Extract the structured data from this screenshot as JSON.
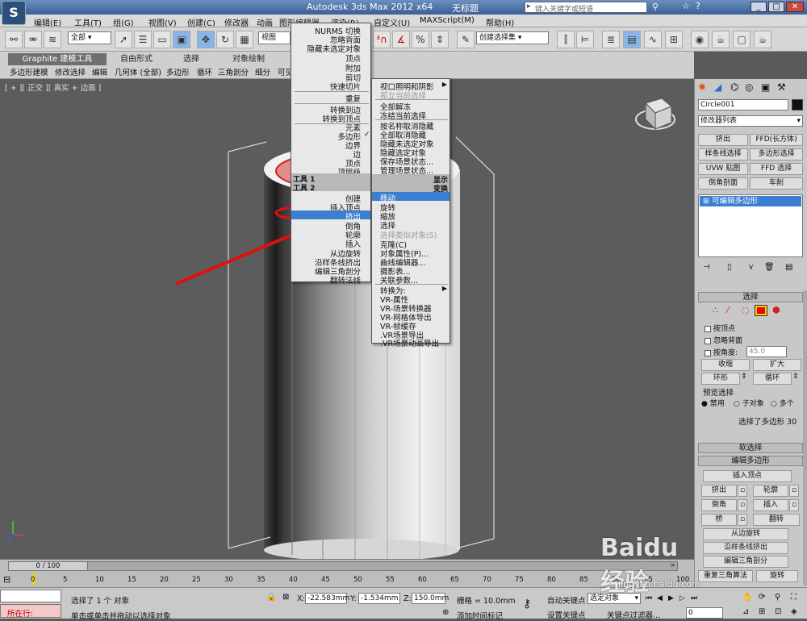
{
  "title": {
    "app": "Autodesk 3ds Max  2012 x64",
    "doc": "无标题",
    "search_placeholder": "键入关键字或短语"
  },
  "menubar": [
    "编辑(E)",
    "工具(T)",
    "组(G)",
    "视图(V)",
    "创建(C)",
    "修改器",
    "动画",
    "图形编辑器",
    "渲染(R)",
    "自定义(U)",
    "MAXScript(M)",
    "帮助(H)"
  ],
  "toolbar": {
    "filter_value": "全部",
    "view_value": "视图",
    "selection_set": "创建选择集"
  },
  "ribbon": {
    "tabs": [
      "Graphite 建模工具",
      "自由形式",
      "选择",
      "对象绘制"
    ],
    "sub": [
      "多边形建模",
      "修改选择",
      "编辑",
      "几何体 (全部)",
      "多边形",
      "循环",
      "三角剖分",
      "细分",
      "可见"
    ]
  },
  "viewport": {
    "label": "[ + ][ 正交 ][ 真实 + 边面 ]"
  },
  "quad_menu_left": {
    "items": [
      "NURMS 切换",
      "忽略背面",
      "隐藏未选定对象",
      "顶点",
      "附加",
      "剪切",
      "快速切片",
      "重复",
      "转换到边",
      "转换到顶点",
      "元素",
      "多边形",
      "边界",
      "边",
      "顶点",
      "顶层级"
    ],
    "tool1": "工具 1",
    "tool2": "工具 2",
    "lower": [
      "创建",
      "插入顶点",
      "挤出",
      "倒角",
      "轮廓",
      "插入",
      "从边旋转",
      "沿样条线挤出",
      "编辑三角剖分",
      "翻转法线"
    ],
    "highlighted": "挤出"
  },
  "quad_menu_right": {
    "upper": [
      "视口照明和阴影",
      "孤立当前选择",
      "全部解冻",
      "冻结当前选择",
      "按名称取消隐藏",
      "全部取消隐藏",
      "隐藏未选定对象",
      "隐藏选定对象",
      "保存场景状态...",
      "管理场景状态..."
    ],
    "display": "显示",
    "transform": "变换",
    "lower": [
      "移动",
      "旋转",
      "缩放",
      "选择",
      "选择类似对象(S)",
      "克隆(C)",
      "对象属性(P)...",
      "曲线编辑器...",
      "摄影表...",
      "关联参数...",
      "转换为:",
      "VR-属性",
      "VR-场景转换器",
      "VR-网格体导出",
      "VR-帧缓存",
      ".VR场景导出",
      ".VR场景动画导出"
    ],
    "highlighted": "移动"
  },
  "command_panel": {
    "object_name": "Circle001",
    "modifier_list": "修改器列表",
    "buttons": [
      "挤出",
      "FFD(长方体)",
      "样条线选择",
      "多边形选择",
      "UVW 贴图",
      "FFD 选择",
      "倒角剖面",
      "车削"
    ],
    "stack_item": "可编辑多边形",
    "selection_title": "选择",
    "checkboxes": [
      "按顶点",
      "忽略背面",
      "按角度:"
    ],
    "angle_value": "45.0",
    "shrink": "收缩",
    "grow": "扩大",
    "ring": "环形",
    "loop": "循环",
    "preview_title": "预览选择",
    "preview_options": [
      "禁用",
      "子对象",
      "多个"
    ],
    "selection_status": "选择了多边形 30",
    "soft_selection": "软选择",
    "edit_poly_title": "编辑多边形",
    "insert_vertex": "插入顶点",
    "edit_buttons": [
      "挤出",
      "轮廓",
      "倒角",
      "插入",
      "桥",
      "翻转"
    ],
    "hinge": "从边旋转",
    "extrude_spline": "沿样条线挤出",
    "edit_tri": "编辑三角剖分",
    "retri": "重复三角算法",
    "turn": "旋转"
  },
  "timeline": {
    "counter": "0 / 100",
    "ticks": [
      "0",
      "5",
      "10",
      "15",
      "20",
      "25",
      "30",
      "35",
      "40",
      "45",
      "50",
      "55",
      "60",
      "65",
      "70",
      "75",
      "80",
      "85",
      "90",
      "95",
      "100"
    ]
  },
  "status": {
    "selected": "选择了 1 个 对象",
    "hint": "单击或单击并拖动以选择对象",
    "running": "所在行:",
    "x_label": "X:",
    "x_val": "-22.583mm",
    "y_label": "Y:",
    "y_val": "-1.534mm",
    "z_label": "Z:",
    "z_val": "150.0mm",
    "grid": "栅格 = 10.0mm",
    "add_tag": "添加时间标记",
    "autokey": "自动关键点",
    "autokey_value": "选定对象",
    "setkey": "设置关键点",
    "key_filter": "关键点过滤器...",
    "frame": "0"
  },
  "watermark": "Baidu经验",
  "watermark_url": "jingyan.baidu.com"
}
